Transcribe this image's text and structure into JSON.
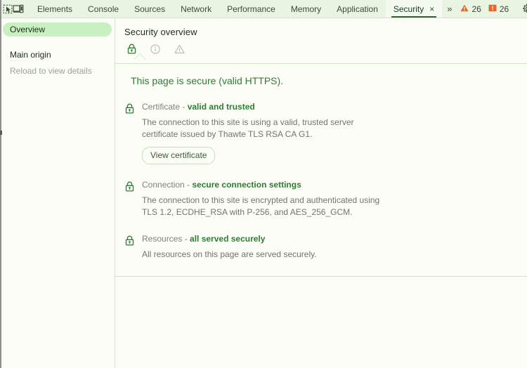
{
  "toolbar": {
    "inspect_icon": "inspect-element-icon",
    "device_icon": "device-toolbar-icon",
    "tabs": [
      {
        "label": "Elements",
        "selected": false
      },
      {
        "label": "Console",
        "selected": false
      },
      {
        "label": "Sources",
        "selected": false
      },
      {
        "label": "Network",
        "selected": false
      },
      {
        "label": "Performance",
        "selected": false
      },
      {
        "label": "Memory",
        "selected": false
      },
      {
        "label": "Application",
        "selected": false
      },
      {
        "label": "Security",
        "selected": true
      }
    ],
    "tab_close_glyph": "×",
    "more_tabs_glyph": "»",
    "warnings_count": "26",
    "issues_count": "26",
    "settings_icon": "gear-icon",
    "more_icon": "kebab-menu-icon",
    "colors": {
      "bar_bg": "#e9f5e2",
      "selected_tab_bg": "#f4faf0",
      "selected_tab_underline": "#36623a",
      "warning_orange": "#e8662a",
      "issue_orange": "#e8662a"
    }
  },
  "sidebar": {
    "overview_label": "Overview",
    "group_title": "Main origin",
    "reload_hint": "Reload to view details",
    "highlight_color": "#c9f0c1"
  },
  "main": {
    "title": "Security overview",
    "status_icons": [
      {
        "name": "lock-icon",
        "state": "secure",
        "selected": true
      },
      {
        "name": "info-icon",
        "state": "info",
        "selected": false
      },
      {
        "name": "warning-triangle-icon",
        "state": "warning",
        "selected": false
      }
    ],
    "headline": "This page is secure (valid HTTPS).",
    "headline_color": "#2e7d33",
    "explanations": [
      {
        "icon": "lock-icon",
        "title_prefix": "Certificate - ",
        "title_emphasis": "valid and trusted",
        "text": "The connection to this site is using a valid, trusted server certificate issued by Thawte TLS RSA CA G1.",
        "button_label": "View certificate"
      },
      {
        "icon": "lock-icon",
        "title_prefix": "Connection - ",
        "title_emphasis": "secure connection settings",
        "text": "The connection to this site is encrypted and authenticated using TLS 1.2, ECDHE_RSA with P-256, and AES_256_GCM.",
        "button_label": null
      },
      {
        "icon": "lock-icon",
        "title_prefix": "Resources - ",
        "title_emphasis": "all served securely",
        "text": "All resources on this page are served securely.",
        "button_label": null
      }
    ]
  }
}
